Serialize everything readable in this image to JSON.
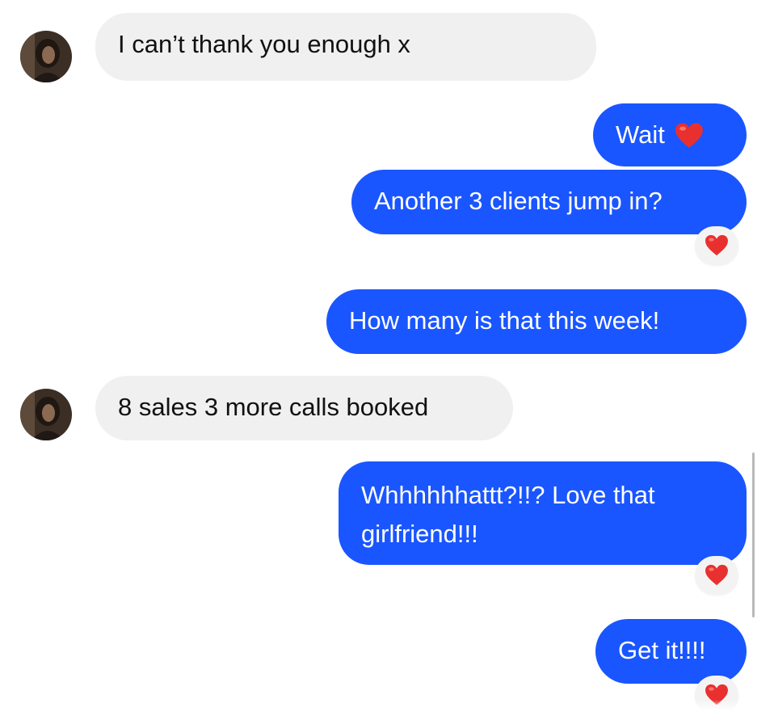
{
  "conversation": {
    "messages": [
      {
        "sender": "contact",
        "text": "I can’t thank you enough x"
      },
      {
        "sender": "me",
        "text": "Wait",
        "inline_emoji": "red-heart"
      },
      {
        "sender": "me",
        "text": "Another 3 clients jump in?",
        "reaction": "red-heart"
      },
      {
        "sender": "me",
        "text": "How many is that this week!"
      },
      {
        "sender": "contact",
        "text": "8 sales 3 more calls booked"
      },
      {
        "sender": "me",
        "text": "Whhhhhhattt?!!? Love that girlfriend!!!",
        "reaction": "red-heart"
      },
      {
        "sender": "me",
        "text": "Get it!!!!",
        "reaction": "red-heart"
      }
    ]
  },
  "colors": {
    "outgoing_bubble": "#1a56ff",
    "incoming_bubble": "#f0f0f1",
    "reaction_heart": "#e8302f",
    "background": "#ffffff"
  }
}
